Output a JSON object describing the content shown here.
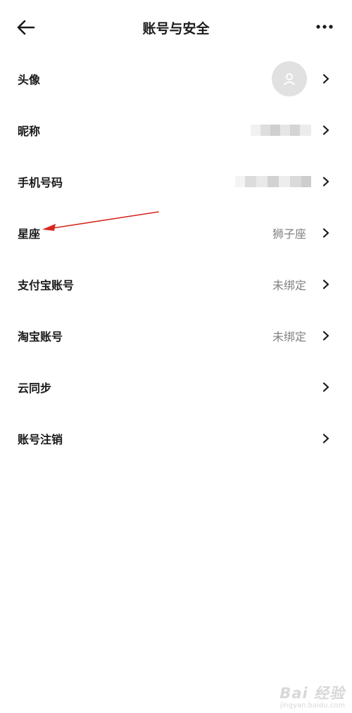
{
  "header": {
    "title": "账号与安全",
    "back_icon": "back-arrow-icon",
    "more_icon": "more-dots-icon"
  },
  "rows": [
    {
      "label": "头像",
      "value": "",
      "kind": "avatar",
      "avatar_icon": "user-icon"
    },
    {
      "label": "昵称",
      "value": "",
      "kind": "blurred"
    },
    {
      "label": "手机号码",
      "value": "",
      "kind": "blurred"
    },
    {
      "label": "星座",
      "value": "狮子座",
      "kind": "text"
    },
    {
      "label": "支付宝账号",
      "value": "未绑定",
      "kind": "text"
    },
    {
      "label": "淘宝账号",
      "value": "未绑定",
      "kind": "text"
    },
    {
      "label": "云同步",
      "value": "",
      "kind": "none"
    },
    {
      "label": "账号注销",
      "value": "",
      "kind": "none"
    }
  ],
  "annotation": {
    "color": "#d6281f"
  },
  "watermark": {
    "main": "Bai 经验",
    "sub": "jingyan.baidu.com"
  },
  "colors": {
    "text": "#1a1a1a",
    "value": "#808080",
    "avatar_bg": "#e1e1e1"
  }
}
